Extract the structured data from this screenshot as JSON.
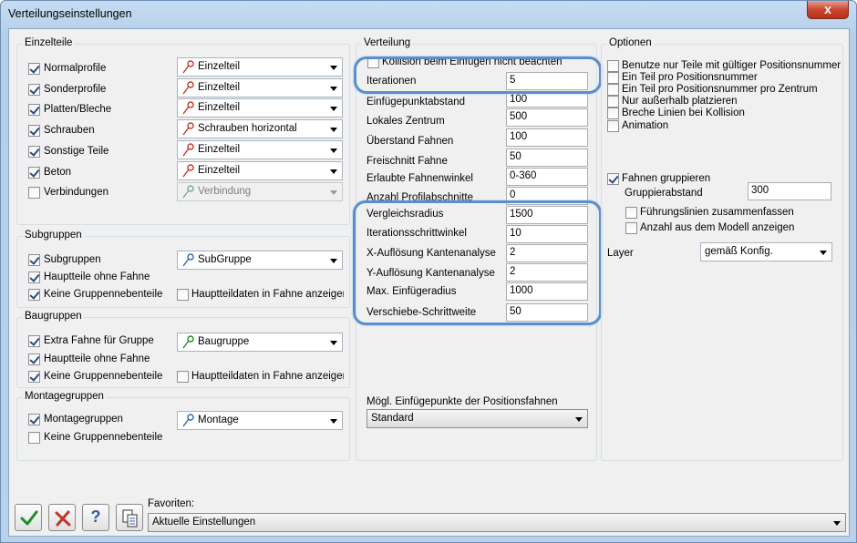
{
  "window": {
    "title": "Verteilungseinstellungen",
    "close": "x"
  },
  "einzelteile": {
    "title": "Einzelteile",
    "rows": [
      {
        "label": "Normalprofile",
        "checked": true,
        "value": "Einzelteil"
      },
      {
        "label": "Sonderprofile",
        "checked": true,
        "value": "Einzelteil"
      },
      {
        "label": "Platten/Bleche",
        "checked": true,
        "value": "Einzelteil"
      },
      {
        "label": "Schrauben",
        "checked": true,
        "value": "Schrauben horizontal"
      },
      {
        "label": "Sonstige Teile",
        "checked": true,
        "value": "Einzelteil"
      },
      {
        "label": "Beton",
        "checked": true,
        "value": "Einzelteil"
      },
      {
        "label": "Verbindungen",
        "checked": false,
        "value": "Verbindung"
      }
    ]
  },
  "subgruppen": {
    "title": "Subgruppen",
    "subgruppen_label": "Subgruppen",
    "subgruppen_value": "SubGruppe",
    "hauptteile_label": "Hauptteile ohne Fahne",
    "keine_label": "Keine Gruppennebenteile",
    "hauptteildaten_label": "Hauptteildaten in Fahne anzeigen"
  },
  "baugruppen": {
    "title": "Baugruppen",
    "extra_label": "Extra Fahne für Gruppe",
    "extra_value": "Baugruppe",
    "hauptteile_label": "Hauptteile ohne Fahne",
    "keine_label": "Keine Gruppennebenteile",
    "hauptteildaten_label": "Hauptteildaten in Fahne anzeigen"
  },
  "montagegruppen": {
    "title": "Montagegruppen",
    "montage_label": "Montagegruppen",
    "montage_value": "Montage",
    "keine_label": "Keine Gruppennebenteile"
  },
  "verteilung": {
    "title": "Verteilung",
    "kollision_label": "Kollision beim Einfügen nicht beachten",
    "fields": [
      {
        "label": "Iterationen",
        "value": "5"
      },
      {
        "label": "Einfügepunktabstand",
        "value": "100"
      },
      {
        "label": "Lokales Zentrum",
        "value": "500"
      },
      {
        "label": "Überstand Fahnen",
        "value": "100"
      },
      {
        "label": "Freischnitt Fahne",
        "value": "50"
      },
      {
        "label": "Erlaubte Fahnenwinkel",
        "value": "0-360"
      },
      {
        "label": "Anzahl Profilabschnitte",
        "value": "0"
      },
      {
        "label": "Vergleichsradius",
        "value": "1500"
      },
      {
        "label": "Iterationsschrittwinkel",
        "value": "10"
      },
      {
        "label": "X-Auflösung Kantenanalyse",
        "value": "2"
      },
      {
        "label": "Y-Auflösung Kantenanalyse",
        "value": "2"
      },
      {
        "label": "Max. Einfügeradius",
        "value": "1000"
      },
      {
        "label": "Verschiebe-Schrittweite",
        "value": "50"
      }
    ],
    "einfuegepunkte_label": "Mögl. Einfügepunkte der Positionsfahnen",
    "einfuegepunkte_value": "Standard"
  },
  "optionen": {
    "title": "Optionen",
    "checks": [
      {
        "label": "Benutze nur Teile mit gültiger Positionsnummer",
        "checked": false
      },
      {
        "label": "Ein Teil pro Positionsnummer",
        "checked": false
      },
      {
        "label": "Ein Teil pro Positionsnummer pro Zentrum",
        "checked": false
      },
      {
        "label": "Nur außerhalb platzieren",
        "checked": false
      },
      {
        "label": "Breche Linien bei Kollision",
        "checked": false
      },
      {
        "label": "Animation",
        "checked": false
      }
    ],
    "fahnen_gruppieren_label": "Fahnen gruppieren",
    "gruppierabstand_label": "Gruppierabstand",
    "gruppierabstand_value": "300",
    "fuehrungslinien_label": "Führungslinien zusammenfassen",
    "anzahl_label": "Anzahl aus dem Modell anzeigen",
    "layer_label": "Layer",
    "layer_value": "gemäß Konfig."
  },
  "footer": {
    "favoriten_label": "Favoriten:",
    "favoriten_value": "Aktuelle Einstellungen",
    "help_glyph": "?"
  },
  "colors": {
    "highlight": "#5b8fc9",
    "accent_red": "#c0392b",
    "accent_green": "#1e8a2a"
  }
}
